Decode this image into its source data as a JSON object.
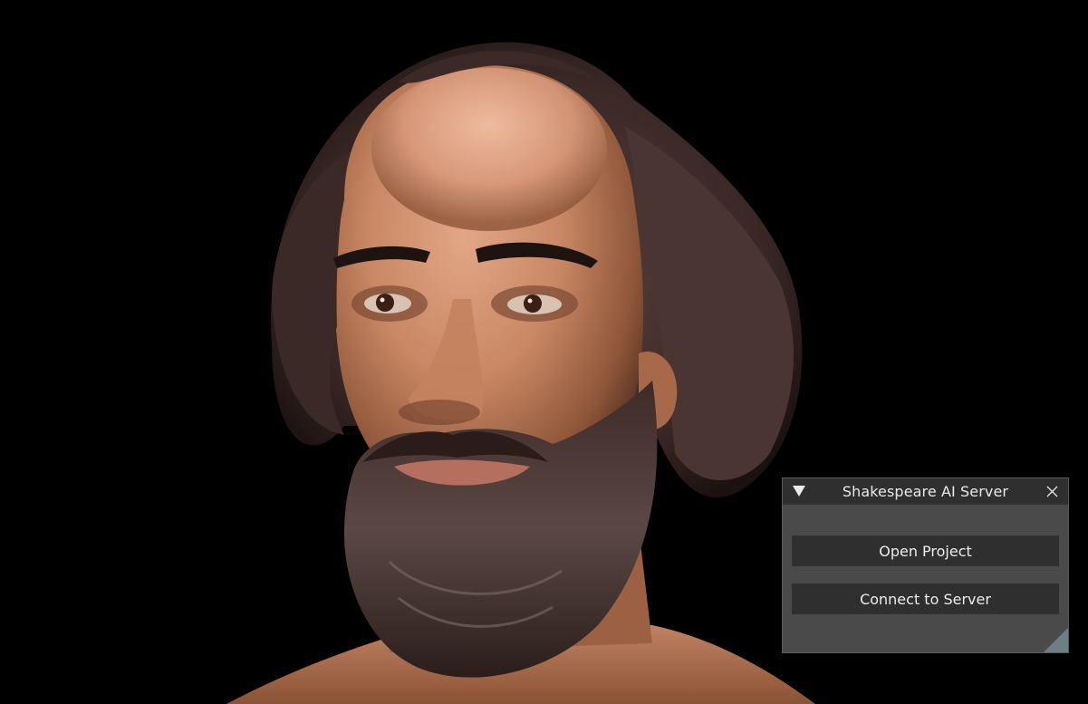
{
  "window": {
    "title": "Shakespeare AI Server",
    "collapse_icon": "triangle-down-icon",
    "close_icon": "close-icon"
  },
  "buttons": {
    "open_project": "Open Project",
    "connect_server": "Connect to Server"
  },
  "colors": {
    "viewport_background": "#000000",
    "window_background": "#4a4a4a",
    "titlebar_background": "#2f2f2f",
    "button_background": "#2f2f2f",
    "text": "#ececec",
    "resize_grip": "#6c7f87"
  }
}
